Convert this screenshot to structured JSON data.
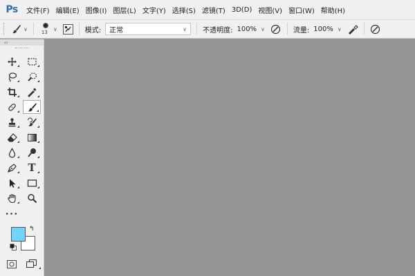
{
  "app": {
    "logo": "Ps"
  },
  "menu": [
    "文件(F)",
    "编辑(E)",
    "图像(I)",
    "图层(L)",
    "文字(Y)",
    "选择(S)",
    "滤镜(T)",
    "3D(D)",
    "视图(V)",
    "窗口(W)",
    "帮助(H)"
  ],
  "options": {
    "brush_size": "13",
    "mode_label": "模式:",
    "mode_value": "正常",
    "opacity_label": "不透明度:",
    "opacity_value": "100%",
    "flow_label": "流量:",
    "flow_value": "100%"
  },
  "toolbox": {
    "collapse_label": "‹‹",
    "more_label": "•••",
    "tools": [
      {
        "name": "move-tool",
        "icon": "move-icon"
      },
      {
        "name": "marquee-tool",
        "icon": "marquee-icon"
      },
      {
        "name": "lasso-tool",
        "icon": "lasso-icon"
      },
      {
        "name": "quick-select-tool",
        "icon": "quick-select-icon"
      },
      {
        "name": "crop-tool",
        "icon": "crop-icon"
      },
      {
        "name": "eyedropper-tool",
        "icon": "eyedropper-icon"
      },
      {
        "name": "healing-brush-tool",
        "icon": "bandage-icon"
      },
      {
        "name": "brush-tool",
        "icon": "brush-icon"
      },
      {
        "name": "clone-stamp-tool",
        "icon": "stamp-icon"
      },
      {
        "name": "history-brush-tool",
        "icon": "history-brush-icon"
      },
      {
        "name": "eraser-tool",
        "icon": "eraser-icon"
      },
      {
        "name": "gradient-tool",
        "icon": "gradient-icon"
      },
      {
        "name": "blur-tool",
        "icon": "blur-icon"
      },
      {
        "name": "dodge-tool",
        "icon": "dodge-icon"
      },
      {
        "name": "pen-tool",
        "icon": "pen-icon"
      },
      {
        "name": "type-tool",
        "icon": "type-icon"
      },
      {
        "name": "path-select-tool",
        "icon": "arrow-icon"
      },
      {
        "name": "rectangle-tool",
        "icon": "rectangle-icon"
      },
      {
        "name": "hand-tool",
        "icon": "hand-icon"
      },
      {
        "name": "zoom-tool",
        "icon": "zoom-icon"
      }
    ],
    "type_glyph": "T",
    "swap_glyph": "↰"
  },
  "colors": {
    "foreground": "#72d3ff",
    "background": "#ffffff",
    "canvas": "#969696",
    "logo": "#2e6fb5"
  }
}
